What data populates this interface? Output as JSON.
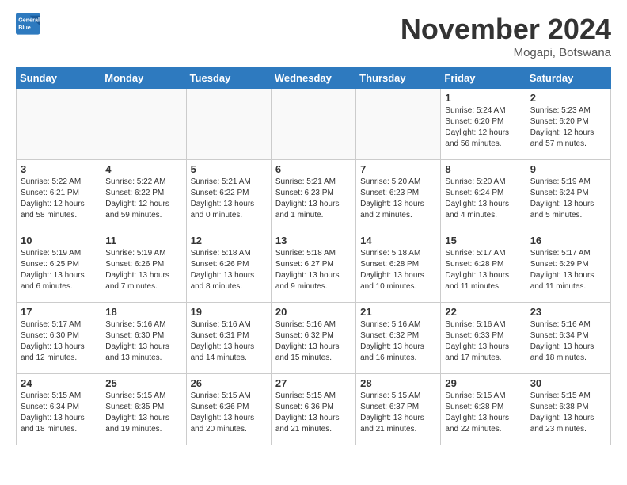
{
  "header": {
    "logo_line1": "General",
    "logo_line2": "Blue",
    "month_title": "November 2024",
    "location": "Mogapi, Botswana"
  },
  "weekdays": [
    "Sunday",
    "Monday",
    "Tuesday",
    "Wednesday",
    "Thursday",
    "Friday",
    "Saturday"
  ],
  "weeks": [
    [
      {
        "day": "",
        "info": ""
      },
      {
        "day": "",
        "info": ""
      },
      {
        "day": "",
        "info": ""
      },
      {
        "day": "",
        "info": ""
      },
      {
        "day": "",
        "info": ""
      },
      {
        "day": "1",
        "info": "Sunrise: 5:24 AM\nSunset: 6:20 PM\nDaylight: 12 hours\nand 56 minutes."
      },
      {
        "day": "2",
        "info": "Sunrise: 5:23 AM\nSunset: 6:20 PM\nDaylight: 12 hours\nand 57 minutes."
      }
    ],
    [
      {
        "day": "3",
        "info": "Sunrise: 5:22 AM\nSunset: 6:21 PM\nDaylight: 12 hours\nand 58 minutes."
      },
      {
        "day": "4",
        "info": "Sunrise: 5:22 AM\nSunset: 6:22 PM\nDaylight: 12 hours\nand 59 minutes."
      },
      {
        "day": "5",
        "info": "Sunrise: 5:21 AM\nSunset: 6:22 PM\nDaylight: 13 hours\nand 0 minutes."
      },
      {
        "day": "6",
        "info": "Sunrise: 5:21 AM\nSunset: 6:23 PM\nDaylight: 13 hours\nand 1 minute."
      },
      {
        "day": "7",
        "info": "Sunrise: 5:20 AM\nSunset: 6:23 PM\nDaylight: 13 hours\nand 2 minutes."
      },
      {
        "day": "8",
        "info": "Sunrise: 5:20 AM\nSunset: 6:24 PM\nDaylight: 13 hours\nand 4 minutes."
      },
      {
        "day": "9",
        "info": "Sunrise: 5:19 AM\nSunset: 6:24 PM\nDaylight: 13 hours\nand 5 minutes."
      }
    ],
    [
      {
        "day": "10",
        "info": "Sunrise: 5:19 AM\nSunset: 6:25 PM\nDaylight: 13 hours\nand 6 minutes."
      },
      {
        "day": "11",
        "info": "Sunrise: 5:19 AM\nSunset: 6:26 PM\nDaylight: 13 hours\nand 7 minutes."
      },
      {
        "day": "12",
        "info": "Sunrise: 5:18 AM\nSunset: 6:26 PM\nDaylight: 13 hours\nand 8 minutes."
      },
      {
        "day": "13",
        "info": "Sunrise: 5:18 AM\nSunset: 6:27 PM\nDaylight: 13 hours\nand 9 minutes."
      },
      {
        "day": "14",
        "info": "Sunrise: 5:18 AM\nSunset: 6:28 PM\nDaylight: 13 hours\nand 10 minutes."
      },
      {
        "day": "15",
        "info": "Sunrise: 5:17 AM\nSunset: 6:28 PM\nDaylight: 13 hours\nand 11 minutes."
      },
      {
        "day": "16",
        "info": "Sunrise: 5:17 AM\nSunset: 6:29 PM\nDaylight: 13 hours\nand 11 minutes."
      }
    ],
    [
      {
        "day": "17",
        "info": "Sunrise: 5:17 AM\nSunset: 6:30 PM\nDaylight: 13 hours\nand 12 minutes."
      },
      {
        "day": "18",
        "info": "Sunrise: 5:16 AM\nSunset: 6:30 PM\nDaylight: 13 hours\nand 13 minutes."
      },
      {
        "day": "19",
        "info": "Sunrise: 5:16 AM\nSunset: 6:31 PM\nDaylight: 13 hours\nand 14 minutes."
      },
      {
        "day": "20",
        "info": "Sunrise: 5:16 AM\nSunset: 6:32 PM\nDaylight: 13 hours\nand 15 minutes."
      },
      {
        "day": "21",
        "info": "Sunrise: 5:16 AM\nSunset: 6:32 PM\nDaylight: 13 hours\nand 16 minutes."
      },
      {
        "day": "22",
        "info": "Sunrise: 5:16 AM\nSunset: 6:33 PM\nDaylight: 13 hours\nand 17 minutes."
      },
      {
        "day": "23",
        "info": "Sunrise: 5:16 AM\nSunset: 6:34 PM\nDaylight: 13 hours\nand 18 minutes."
      }
    ],
    [
      {
        "day": "24",
        "info": "Sunrise: 5:15 AM\nSunset: 6:34 PM\nDaylight: 13 hours\nand 18 minutes."
      },
      {
        "day": "25",
        "info": "Sunrise: 5:15 AM\nSunset: 6:35 PM\nDaylight: 13 hours\nand 19 minutes."
      },
      {
        "day": "26",
        "info": "Sunrise: 5:15 AM\nSunset: 6:36 PM\nDaylight: 13 hours\nand 20 minutes."
      },
      {
        "day": "27",
        "info": "Sunrise: 5:15 AM\nSunset: 6:36 PM\nDaylight: 13 hours\nand 21 minutes."
      },
      {
        "day": "28",
        "info": "Sunrise: 5:15 AM\nSunset: 6:37 PM\nDaylight: 13 hours\nand 21 minutes."
      },
      {
        "day": "29",
        "info": "Sunrise: 5:15 AM\nSunset: 6:38 PM\nDaylight: 13 hours\nand 22 minutes."
      },
      {
        "day": "30",
        "info": "Sunrise: 5:15 AM\nSunset: 6:38 PM\nDaylight: 13 hours\nand 23 minutes."
      }
    ]
  ]
}
